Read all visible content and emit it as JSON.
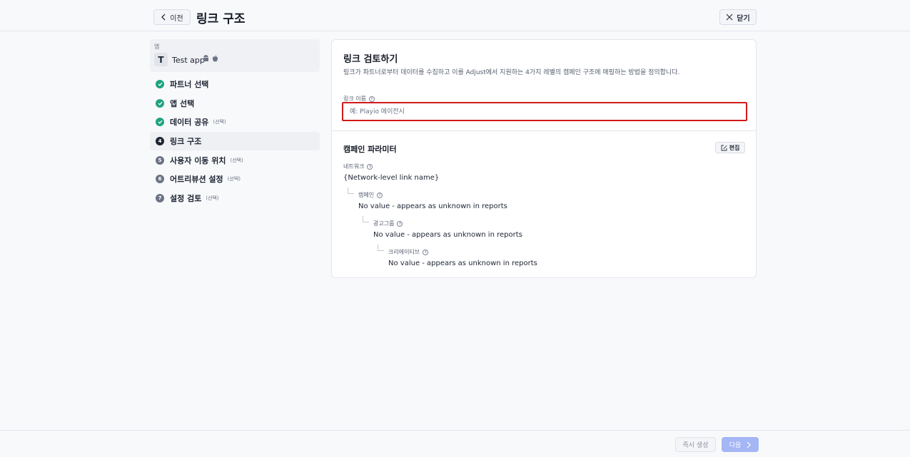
{
  "header": {
    "back_label": "이전",
    "title": "링크 구조",
    "close_label": "닫기"
  },
  "sidebar": {
    "app_section_label": "앱",
    "app_avatar_letter": "T",
    "app_name": "Test app",
    "app_platform_icons": [
      "android-icon",
      "apple-icon"
    ],
    "steps": [
      {
        "number": "1",
        "label": "파트너 선택",
        "optional": "",
        "state": "done"
      },
      {
        "number": "2",
        "label": "앱 선택",
        "optional": "",
        "state": "done"
      },
      {
        "number": "3",
        "label": "데이터 공유",
        "optional": "(선택)",
        "state": "done"
      },
      {
        "number": "4",
        "label": "링크 구조",
        "optional": "",
        "state": "current"
      },
      {
        "number": "5",
        "label": "사용자 이동 위치",
        "optional": "(선택)",
        "state": "todo"
      },
      {
        "number": "6",
        "label": "어트리뷰션 설정",
        "optional": "(선택)",
        "state": "todo"
      },
      {
        "number": "7",
        "label": "설정 검토",
        "optional": "(선택)",
        "state": "todo"
      }
    ]
  },
  "card": {
    "title": "링크 검토하기",
    "description": "링크가 파트너로부터 데이터를 수집하고 이를 Adjust에서 지원하는 4가지 레벨의 캠페인 구조에 매핑하는 방법을 정의합니다.",
    "link_name_label": "링크 이름",
    "link_name_placeholder": "예: Playio 에이전시",
    "link_name_value": "",
    "params_title": "캠페인 파라미터",
    "edit_label": "편집",
    "params": [
      {
        "label": "네트워크",
        "value": "{Network-level link name}"
      },
      {
        "label": "캠페인",
        "value": "No value - appears as unknown in reports"
      },
      {
        "label": "광고그룹",
        "value": "No value - appears as unknown in reports"
      },
      {
        "label": "크리에이티브",
        "value": "No value - appears as unknown in reports"
      }
    ]
  },
  "footer": {
    "instant_create_label": "즉시 생성",
    "next_label": "다음"
  },
  "colors": {
    "done": "#1ea37f",
    "primary_disabled": "#a4b6f4",
    "highlight_border": "#d21a1a"
  }
}
